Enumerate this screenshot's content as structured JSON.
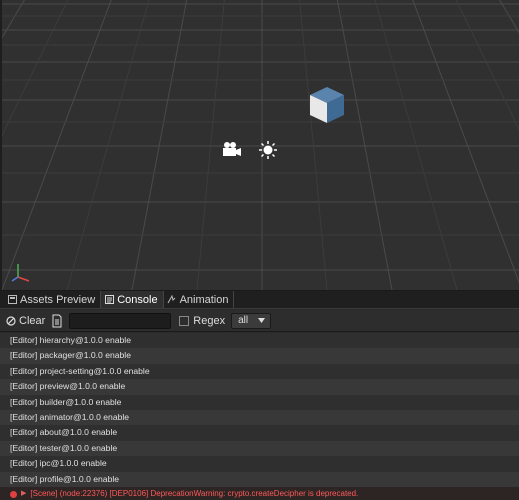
{
  "tabs": [
    {
      "label": "Assets Preview",
      "icon": "assets-preview-icon",
      "active": false
    },
    {
      "label": "Console",
      "icon": "console-icon",
      "active": true
    },
    {
      "label": "Animation",
      "icon": "animation-icon",
      "active": false
    }
  ],
  "toolbar": {
    "clear_label": "Clear",
    "search_placeholder": "",
    "search_value": "",
    "regex_label": "Regex",
    "level_value": "all"
  },
  "logs": [
    "[Editor] hierarchy@1.0.0 enable",
    "[Editor] packager@1.0.0 enable",
    "[Editor] project-setting@1.0.0 enable",
    "[Editor] preview@1.0.0 enable",
    "[Editor] builder@1.0.0 enable",
    "[Editor] animator@1.0.0 enable",
    "[Editor] about@1.0.0 enable",
    "[Editor] tester@1.0.0 enable",
    "[Editor] ipc@1.0.0 enable",
    "[Editor] profile@1.0.0 enable"
  ],
  "error": {
    "text": "[Scene] (node:22376) [DEP0106] DeprecationWarning: crypto.createDecipher is deprecated.",
    "color": "#ff5a5a"
  },
  "colors": {
    "scene_bg": "#303030",
    "cube_top": "#5a84ad",
    "cube_left": "#e8e8e8",
    "cube_right": "#3f6a94"
  }
}
